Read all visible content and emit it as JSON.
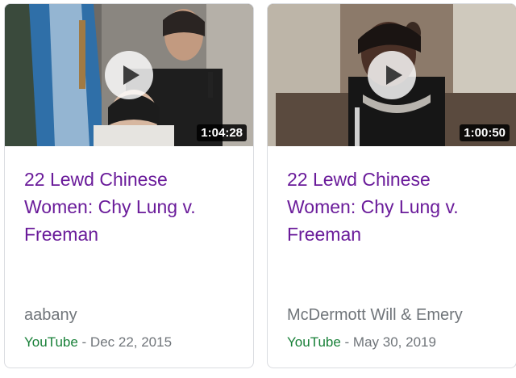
{
  "cards": [
    {
      "duration": "1:04:28",
      "title": "22 Lewd Chinese Women: Chy Lung v. Freeman",
      "channel": "aabany",
      "source": "YouTube",
      "separator": " - ",
      "date": "Dec 22, 2015"
    },
    {
      "duration": "1:00:50",
      "title": "22 Lewd Chinese Women: Chy Lung v. Freeman",
      "channel": "McDermott Will & Emery",
      "source": "YouTube",
      "separator": " - ",
      "date": "May 30, 2019"
    }
  ],
  "colors": {
    "title": "#6a1b9a",
    "source": "#188038",
    "meta": "#70757a",
    "card_border": "#dadce0"
  },
  "icons": {
    "play": "play-icon"
  }
}
